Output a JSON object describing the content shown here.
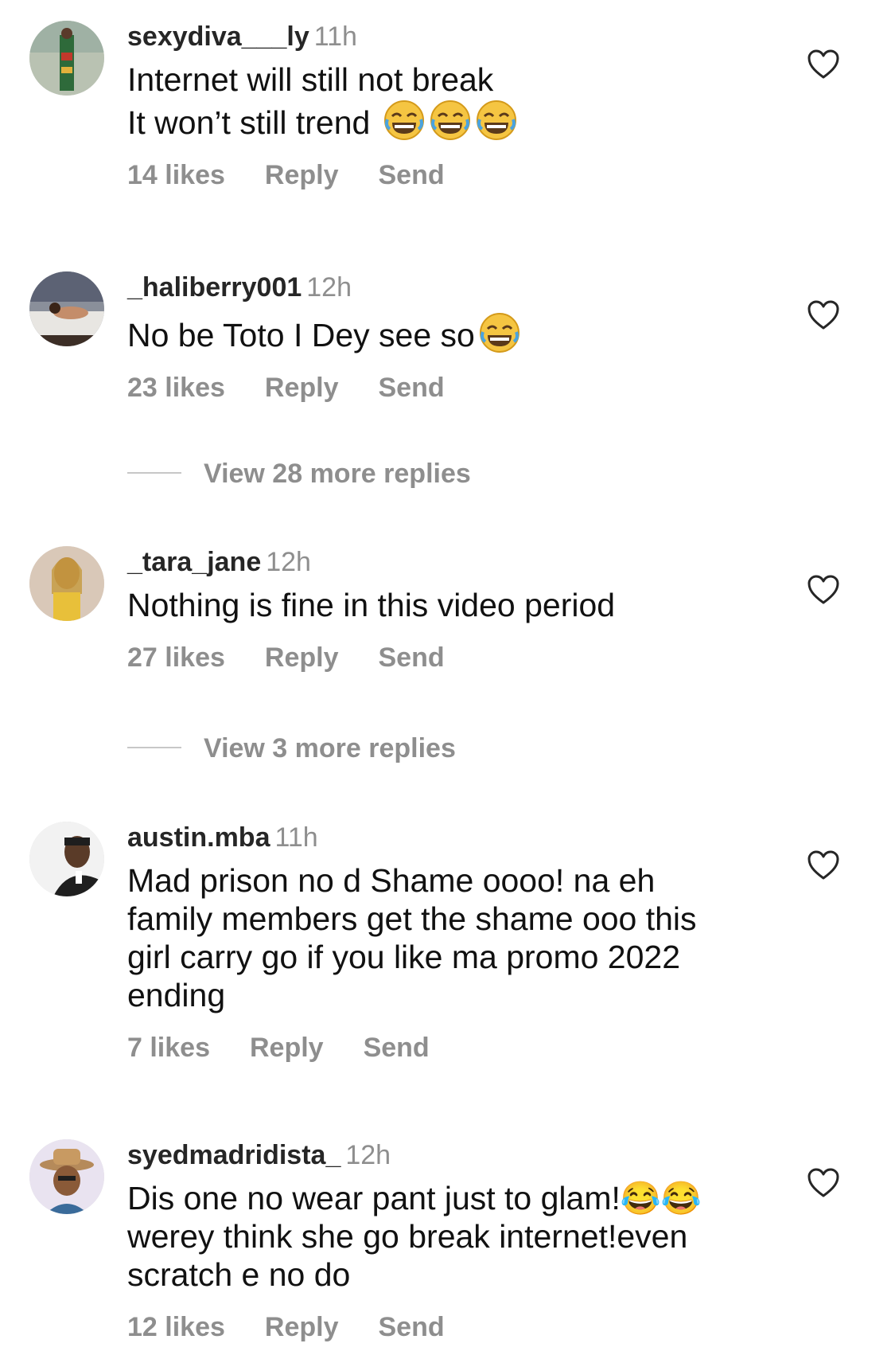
{
  "comments": [
    {
      "username": "sexydiva___ly",
      "time": "11h",
      "text": "Internet will still not break\nIt won’t still trend",
      "emoji": "😂😂😂",
      "likes": "14 likes",
      "reply": "Reply",
      "send": "Send"
    },
    {
      "username": "_haliberry001",
      "time": "12h",
      "text": "No be Toto I Dey see so",
      "emoji": "😂",
      "likes": "23 likes",
      "reply": "Reply",
      "send": "Send",
      "view_more": "View 28 more replies"
    },
    {
      "username": "_tara_jane",
      "time": "12h",
      "text": "Nothing is fine in this video period",
      "emoji": "",
      "likes": "27 likes",
      "reply": "Reply",
      "send": "Send",
      "view_more": "View 3 more replies"
    },
    {
      "username": "austin.mba",
      "time": "11h",
      "text": "Mad prison no d Shame oooo! na eh\nfamily members get the shame ooo this\ngirl carry go if you like ma  promo 2022\nending",
      "emoji": "",
      "likes": "7 likes",
      "reply": "Reply",
      "send": "Send"
    },
    {
      "username": "syedmadridista_",
      "time": "12h",
      "text": "Dis one no wear pant just to glam!😂😂\nwerey think she go break internet!even\nscratch e no do",
      "emoji": "",
      "likes": "12 likes",
      "reply": "Reply",
      "send": "Send"
    }
  ],
  "icons": {
    "like": "heart-outline-icon",
    "emoji": "face-with-tears-of-joy"
  },
  "colors": {
    "primary_text": "#111111",
    "username": "#262626",
    "secondary_text": "#8e8e8e",
    "divider": "#c7c7c7"
  }
}
